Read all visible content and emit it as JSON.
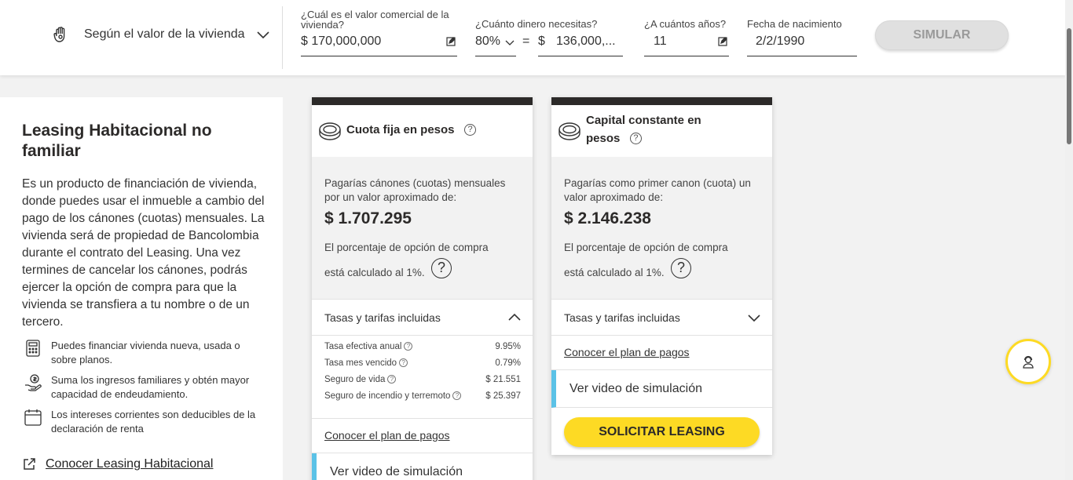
{
  "simulator": {
    "mode_label": "Según el valor de la vivienda",
    "valor_label": "¿Cuál es el valor comercial de la vivienda?",
    "valor_value": "$ 170,000,000",
    "dinero_label": "¿Cuánto dinero necesitas?",
    "percent_value": "80%",
    "equals": "=",
    "currency": "$",
    "dinero_value": "136,000,...",
    "anos_label": "¿A cuántos años?",
    "anos_value": "11",
    "fecha_label": "Fecha de nacimiento",
    "fecha_value": "2/2/1990",
    "simular_label": "SIMULAR"
  },
  "info": {
    "title": "Leasing Habitacional no familiar",
    "description": "Es un producto de financiación de vivienda, donde puedes usar el inmueble a cambio del pago de los cánones (cuotas) mensuales. La vivienda será de propiedad de Bancolombia durante el contrato del Leasing. Una vez termines de cancelar los cánones, podrás ejercer la opción de compra para que la vivienda se transfiera a tu nombre o de un tercero.",
    "benefits": [
      {
        "icon": "calculator-icon",
        "text": "Puedes financiar vivienda nueva, usada o sobre planos."
      },
      {
        "icon": "hand-money-icon",
        "text": "Suma los ingresos familiares y obtén mayor capacidad de endeudamiento."
      },
      {
        "icon": "calendar-icon",
        "text": "Los intereses corrientes son deducibles de la declaración de renta"
      }
    ],
    "link_label": "Conocer Leasing Habitacional"
  },
  "cards": [
    {
      "title": "Cuota fija en pesos",
      "intro": "Pagarías cánones (cuotas) mensuales por un valor aproximado de:",
      "amount": "$ 1.707.295",
      "pct_line1": "El porcentaje de opción de compra",
      "pct_line2": "está calculado al 1%.",
      "accordion_label": "Tasas y tarifas incluidas",
      "accordion_expanded": true,
      "rates": [
        {
          "name": "Tasa efectiva anual",
          "value": "9.95%"
        },
        {
          "name": "Tasa mes vencido",
          "value": "0.79%"
        },
        {
          "name": "Seguro de vida",
          "value": "$ 21.551"
        },
        {
          "name": "Seguro de incendio y terremoto",
          "value": "$ 25.397"
        }
      ],
      "plan_label": "Conocer el plan de pagos",
      "video_label": "Ver video de simulación"
    },
    {
      "title_line1": "Capital constante en",
      "title_line2": "pesos",
      "intro": "Pagarías como primer canon (cuota) un valor aproximado de:",
      "amount": "$ 2.146.238",
      "pct_line1": "El porcentaje de opción de compra",
      "pct_line2": "está calculado al 1%.",
      "accordion_label": "Tasas y tarifas incluidas",
      "accordion_expanded": false,
      "plan_label": "Conocer el plan de pagos",
      "video_label": "Ver video de simulación",
      "cta_label": "SOLICITAR LEASING"
    }
  ],
  "help_icon": "support-agent-icon",
  "colors": {
    "accent": "#fdda24",
    "dark": "#2c2a29",
    "video_bar": "#5bc2e7"
  },
  "question_mark": "?"
}
